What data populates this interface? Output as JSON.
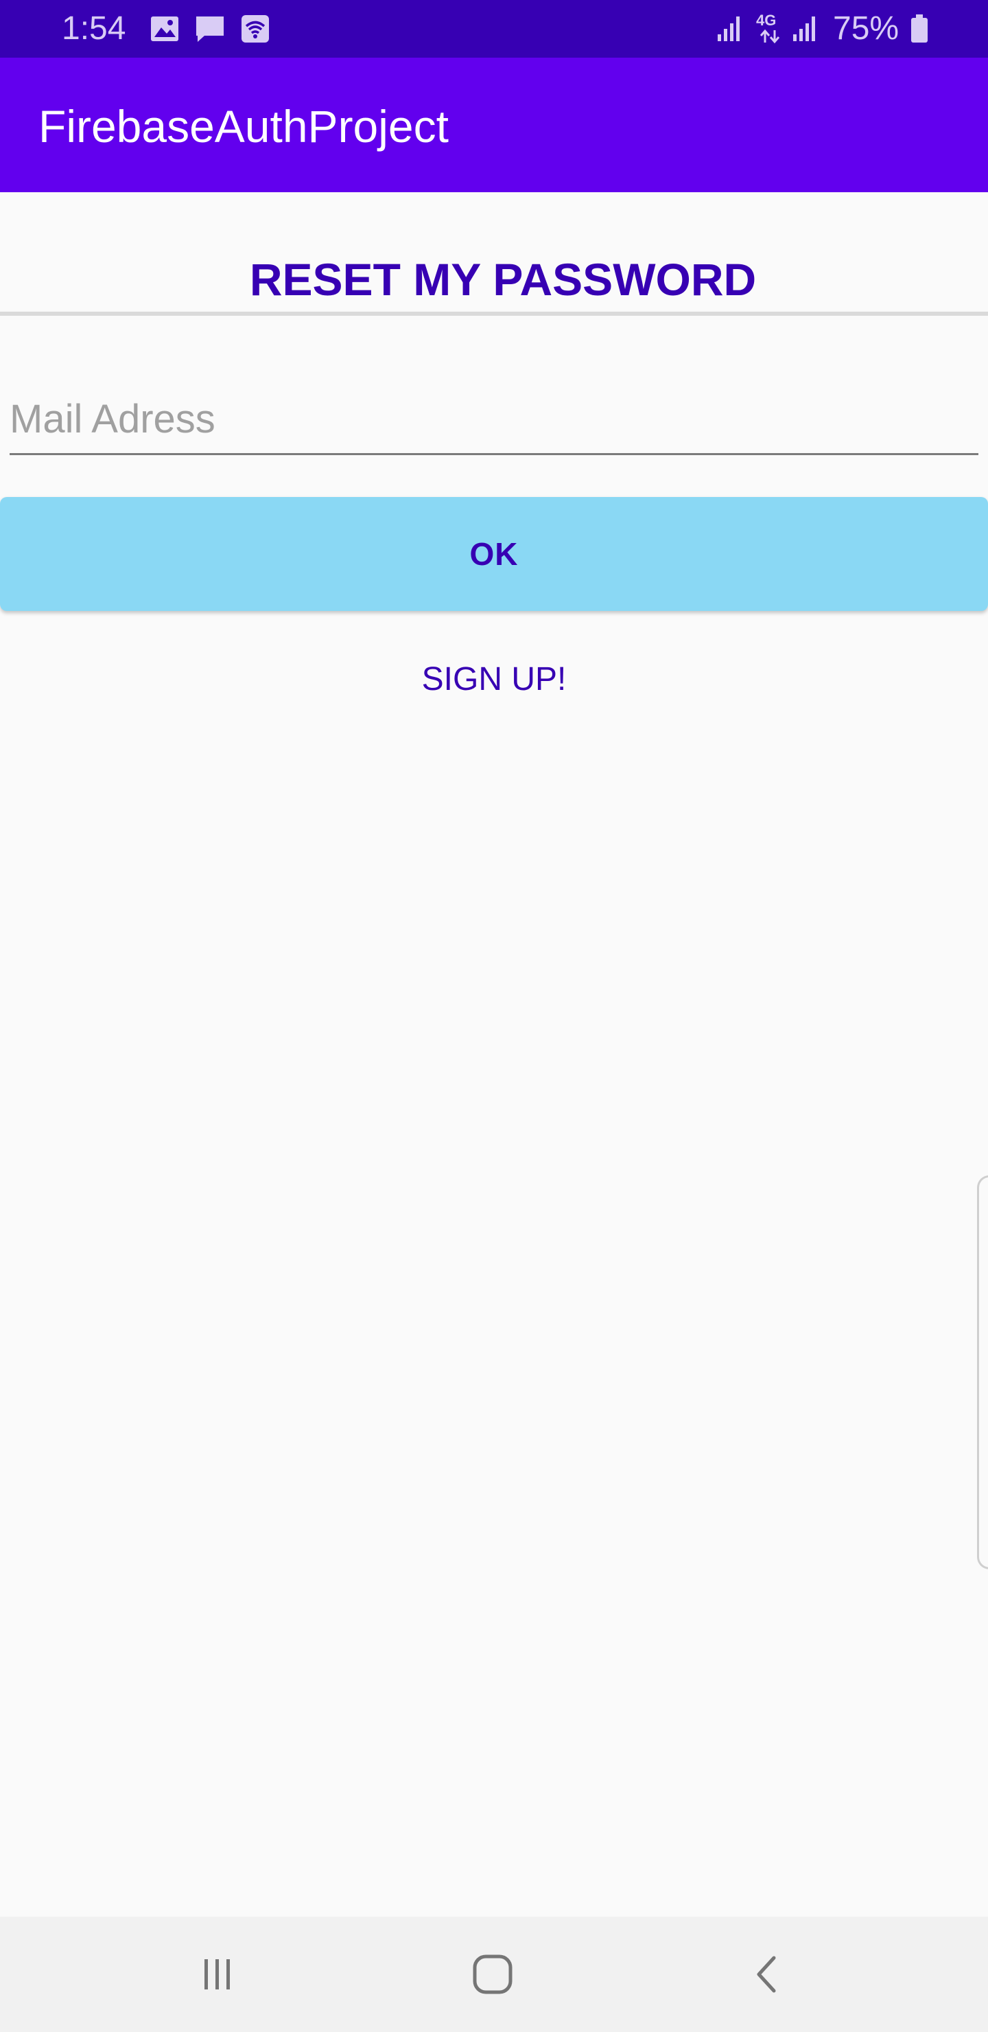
{
  "status_bar": {
    "time": "1:54",
    "battery": "75%",
    "network": "4G",
    "icons": [
      "gallery-icon",
      "message-icon",
      "wifi-icon",
      "signal-icon",
      "mobile-data-icon",
      "signal-icon",
      "battery-icon"
    ]
  },
  "app_bar": {
    "title": "FirebaseAuthProject"
  },
  "main": {
    "title": "RESET MY PASSWORD",
    "mail_input": {
      "value": "",
      "placeholder": "Mail Adress"
    },
    "ok_label": "OK",
    "signup_label": "SIGN UP!"
  },
  "nav_bar": {
    "icons": [
      "recent-apps-icon",
      "home-icon",
      "back-icon"
    ]
  },
  "colors": {
    "status_bar": "#3700B3",
    "app_bar": "#6200EE",
    "accent_text": "#3700B3",
    "button": "#8AD8F4",
    "background": "#FAFAFA",
    "nav_bar": "#F1F1F1"
  }
}
